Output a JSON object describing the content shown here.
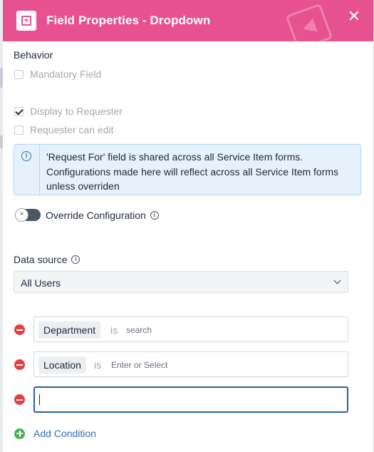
{
  "header": {
    "title": "Field Properties - Dropdown",
    "icon": "dropdown-field-icon",
    "close_icon": "close-icon",
    "brand_color": "#e8518f"
  },
  "behavior": {
    "label": "Behavior",
    "mandatory": {
      "label": "Mandatory Field",
      "checked": false
    },
    "display_to_requester": {
      "label": "Display to Requester",
      "checked": true
    },
    "requester_can_edit": {
      "label": "Requester can edit",
      "checked": false
    }
  },
  "info": {
    "icon": "info-icon",
    "text": "'Request For' field is shared across all Service Item forms. Configurations made here will reflect across all Service Item forms unless overriden"
  },
  "override": {
    "label": "Override Configuration",
    "enabled": false,
    "info_icon": "info-icon"
  },
  "data_source": {
    "label": "Data source",
    "info_icon": "info-icon",
    "selected": "All Users"
  },
  "conditions": [
    {
      "field": "Department",
      "operator": "is",
      "placeholder": "search"
    },
    {
      "field": "Location",
      "operator": "is",
      "placeholder": "Enter or Select"
    },
    {
      "field": "",
      "operator": "",
      "placeholder": ""
    }
  ],
  "add_condition": {
    "label": "Add Condition",
    "icon": "plus-circle-icon"
  }
}
